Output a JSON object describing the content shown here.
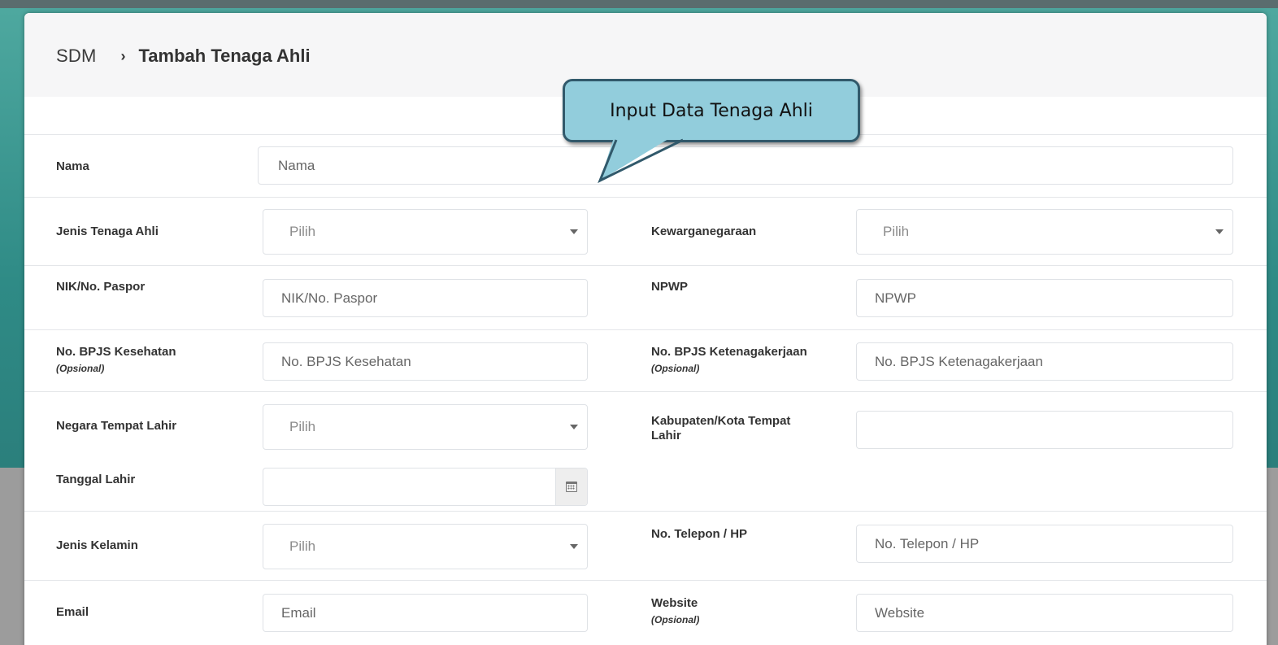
{
  "breadcrumb": {
    "root": "SDM",
    "separator": "›",
    "current": "Tambah Tenaga Ahli"
  },
  "callout": {
    "text": "Input Data Tenaga Ahli"
  },
  "form": {
    "nama": {
      "label": "Nama",
      "placeholder": "Nama"
    },
    "jenis_tenaga_ahli": {
      "label": "Jenis Tenaga Ahli",
      "selected": "Pilih"
    },
    "kewarganegaraan": {
      "label": "Kewarganegaraan",
      "selected": "Pilih"
    },
    "nik": {
      "label": "NIK/No. Paspor",
      "placeholder": "NIK/No. Paspor"
    },
    "npwp": {
      "label": "NPWP",
      "placeholder": "NPWP"
    },
    "bpjs_kesehatan": {
      "label": "No. BPJS Kesehatan",
      "note": "(Opsional)",
      "placeholder": "No. BPJS Kesehatan"
    },
    "bpjs_ketenagakerjaan": {
      "label": "No. BPJS Ketenagakerjaan",
      "note": "(Opsional)",
      "placeholder": "No. BPJS Ketenagakerjaan"
    },
    "negara_tempat_lahir": {
      "label": "Negara Tempat Lahir",
      "selected": "Pilih"
    },
    "kota_tempat_lahir": {
      "label_line1": "Kabupaten/Kota Tempat",
      "label_line2": "Lahir",
      "placeholder": ""
    },
    "tanggal_lahir": {
      "label": "Tanggal Lahir",
      "value": ""
    },
    "jenis_kelamin": {
      "label": "Jenis Kelamin",
      "selected": "Pilih"
    },
    "telepon": {
      "label": "No. Telepon / HP",
      "placeholder": "No. Telepon / HP"
    },
    "email": {
      "label": "Email",
      "placeholder": "Email"
    },
    "website": {
      "label": "Website",
      "note": "(Opsional)",
      "placeholder": "Website"
    }
  },
  "icons": {
    "calendar": "calendar-icon",
    "chevron": "chevron-right-icon",
    "caret": "caret-down-icon"
  },
  "colors": {
    "callout_fill": "#92cddc",
    "callout_border": "#31596b",
    "header_bg": "#f6f6f7",
    "teal_background": "#2f8b86"
  }
}
